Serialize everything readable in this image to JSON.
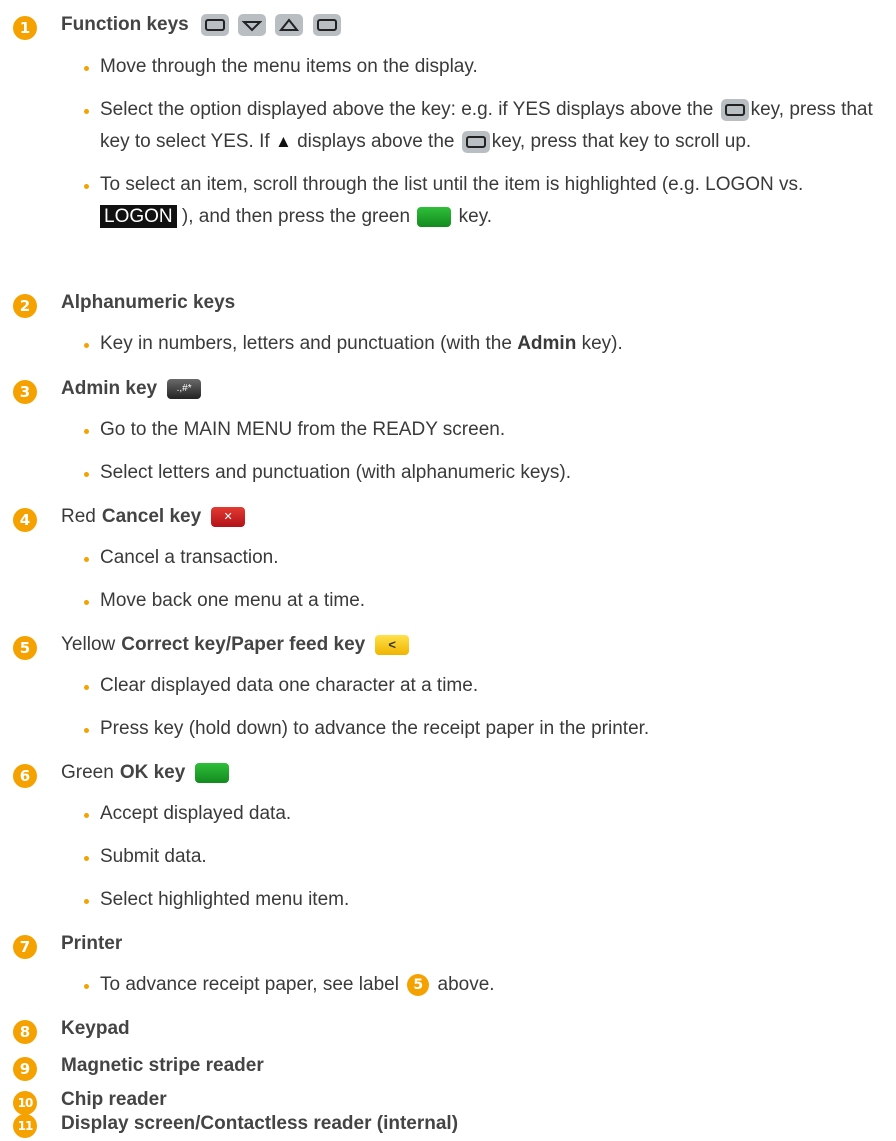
{
  "colors": {
    "accent": "#f5a200",
    "highlight_bg": "#111111"
  },
  "s1": {
    "num": "1",
    "title": "Function keys",
    "b1": "Move through the menu items on the display.",
    "b2": {
      "p1": "Select the option displayed above the key: e.g. if YES displays above the",
      "p2": "key, press that key to select YES. If",
      "tri": "▲",
      "p3": "displays above the",
      "p4": "key, press that key to scroll up."
    },
    "b3": {
      "p1": "To select an item, scroll through the list until the item is highlighted (e.g. LOGON vs.",
      "hl": "LOGON",
      "p2": "), and then press the green",
      "p3": "key."
    }
  },
  "s2": {
    "num": "2",
    "title": "Alphanumeric keys",
    "b1a": "Key in numbers, letters and punctuation (with the ",
    "b1b": "Admin",
    "b1c": " key)."
  },
  "s3": {
    "num": "3",
    "title": "Admin key",
    "key_label": ".,#*",
    "b1": "Go to the MAIN MENU from the READY screen.",
    "b2": "Select letters and punctuation (with alphanumeric keys)."
  },
  "s4": {
    "num": "4",
    "pre": "Red",
    "title": "Cancel key",
    "key_label": "✕",
    "b1": "Cancel a transaction.",
    "b2": "Move back one menu at a time."
  },
  "s5": {
    "num": "5",
    "pre": "Yellow",
    "title": "Correct key/Paper feed key",
    "key_label": "<",
    "b1": "Clear displayed data one character at a time.",
    "b2": "Press key (hold down) to advance the receipt paper in the printer."
  },
  "s6": {
    "num": "6",
    "pre": "Green",
    "title": "OK key",
    "b1": "Accept displayed data.",
    "b2": "Submit data.",
    "b3": "Select highlighted menu item."
  },
  "s7": {
    "num": "7",
    "title": "Printer",
    "b1a": "To advance receipt paper, see label",
    "b1num": "5",
    "b1b": "above."
  },
  "s8": {
    "num": "8",
    "title": "Keypad"
  },
  "s9": {
    "num": "9",
    "title": "Magnetic stripe reader"
  },
  "s10": {
    "num": "10",
    "title": "Chip reader"
  },
  "s11": {
    "num": "11",
    "title": "Display screen/Contactless reader (internal)"
  }
}
